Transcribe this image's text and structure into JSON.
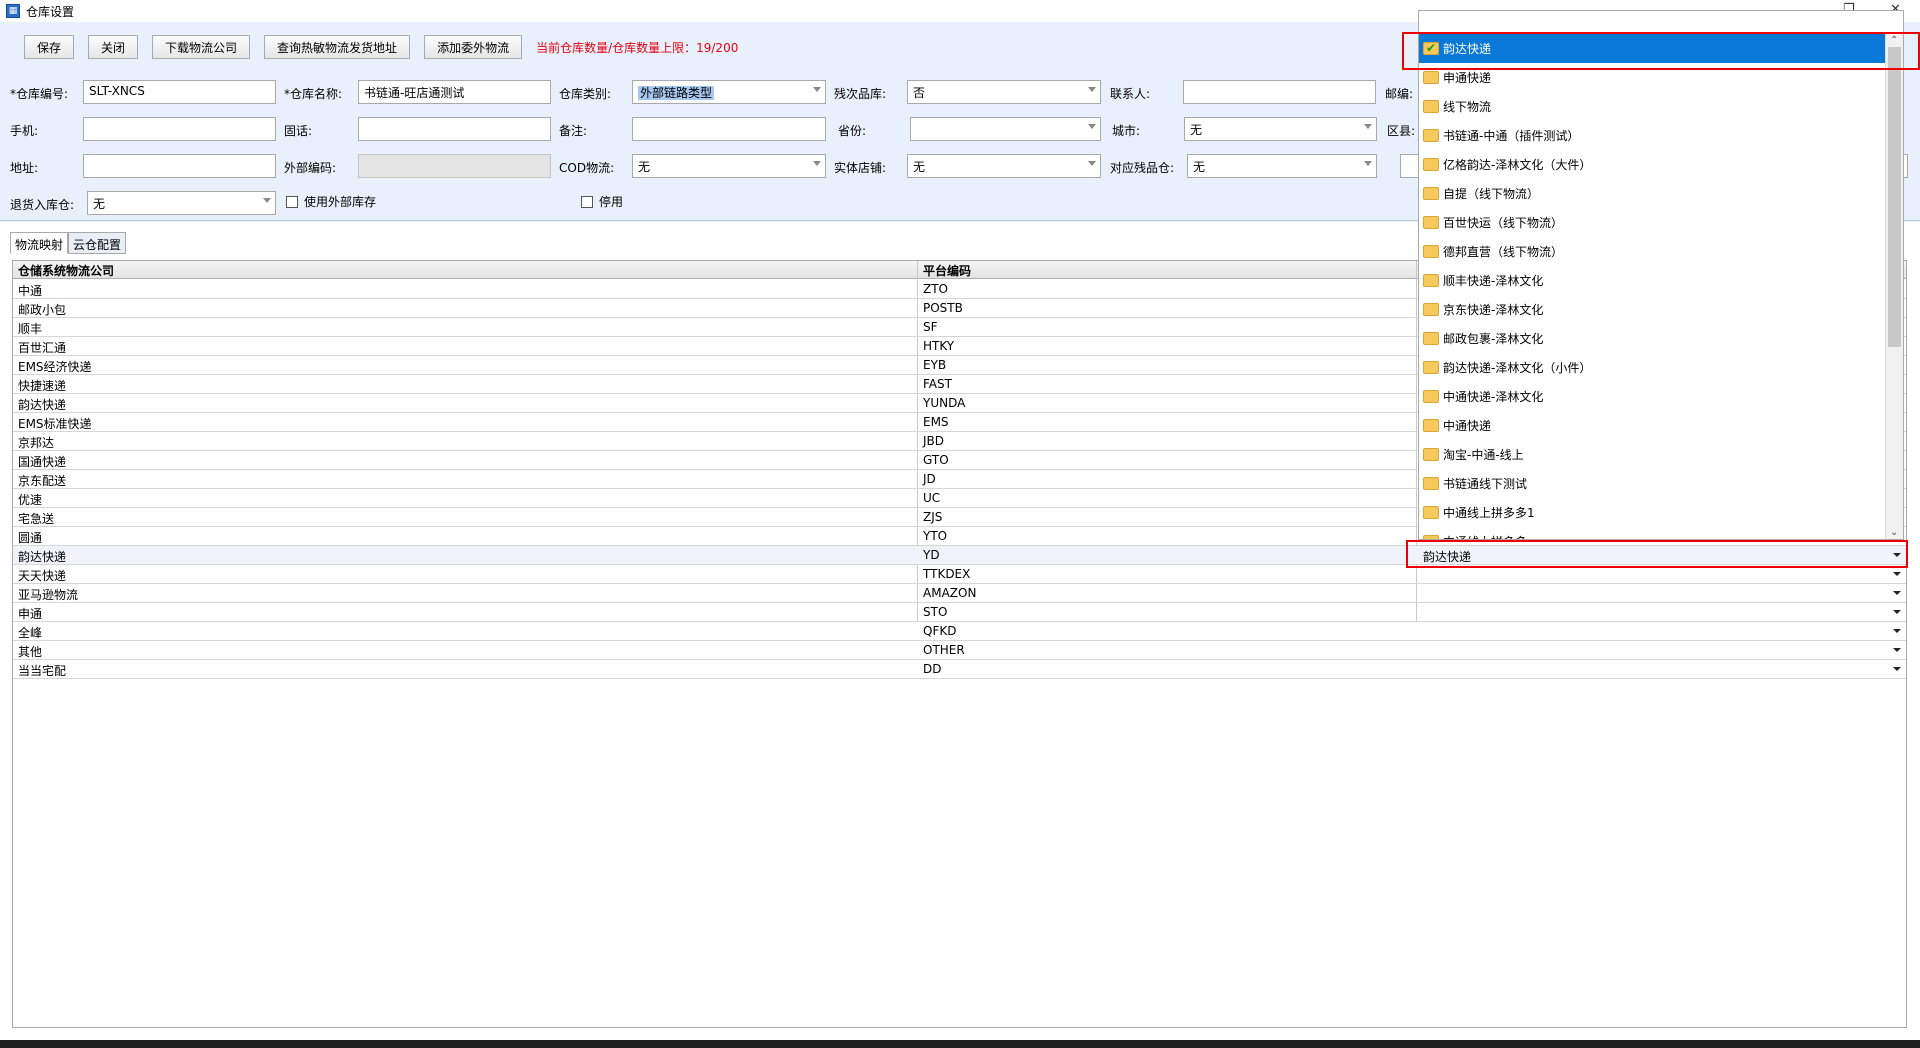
{
  "window": {
    "title": "仓库设置",
    "icon": "window-app-icon",
    "maximize_glyph": "❐",
    "close_glyph": "✕"
  },
  "toolbar": {
    "save": "保存",
    "close": "关闭",
    "download_logistics": "下载物流公司",
    "query_address": "查询热敏物流发货地址",
    "add_outsource": "添加委外物流",
    "quota_text": "当前仓库数量/仓库数量上限：19/200"
  },
  "form": {
    "warehouse_code_label": "*仓库编号:",
    "warehouse_code": "SLT-XNCS",
    "warehouse_name_label": "*仓库名称:",
    "warehouse_name": "书链通-旺店通测试",
    "warehouse_type_label": "仓库类别:",
    "warehouse_type": "外部链路类型",
    "defect_label": "残次品库:",
    "defect_value": "否",
    "contact_label": "联系人:",
    "postcode_label": "邮编:",
    "mobile_label": "手机:",
    "phone_label": "固话:",
    "remark_label": "备注:",
    "province_label": "省份:",
    "city_label": "城市:",
    "city_value": "无",
    "district_label": "区县:",
    "address_label": "地址:",
    "external_code_label": "外部编码:",
    "cod_label": "COD物流:",
    "cod_value": "无",
    "store_label": "实体店铺:",
    "store_value": "无",
    "defect_warehouse_label": "对应残品仓:",
    "defect_warehouse_value": "无",
    "return_warehouse_label": "退货入库仓:",
    "return_warehouse_value": "无",
    "use_external_stock": "使用外部库存",
    "disabled": "停用"
  },
  "tabs": [
    "物流映射",
    "云仓配置"
  ],
  "grid": {
    "headers": [
      "仓储系统物流公司",
      "平台编码"
    ],
    "rows": [
      [
        "中通",
        "ZTO"
      ],
      [
        "邮政小包",
        "POSTB"
      ],
      [
        "顺丰",
        "SF"
      ],
      [
        "百世汇通",
        "HTKY"
      ],
      [
        "EMS经济快递",
        "EYB"
      ],
      [
        "快捷速递",
        "FAST"
      ],
      [
        "韵达快递",
        "YUNDA"
      ],
      [
        "EMS标准快递",
        "EMS"
      ],
      [
        "京邦达",
        "JBD"
      ],
      [
        "国通快递",
        "GTO"
      ],
      [
        "京东配送",
        "JD"
      ],
      [
        "优速",
        "UC"
      ],
      [
        "宅急送",
        "ZJS"
      ],
      [
        "圆通",
        "YTO"
      ],
      [
        "韵达快递",
        "YD"
      ],
      [
        "天天快递",
        "TTKDEX"
      ],
      [
        "亚马逊物流",
        "AMAZON"
      ],
      [
        "申通",
        "STO"
      ],
      [
        "全峰",
        "QFKD"
      ],
      [
        "其他",
        "OTHER"
      ],
      [
        "当当宅配",
        "DD"
      ]
    ],
    "selected_combo_value": "韵达快递"
  },
  "dropdown": {
    "items": [
      "韵达快递",
      "申通快递",
      "线下物流",
      "书链通-中通（插件测试）",
      "亿格韵达-泽林文化（大件）",
      "自提（线下物流）",
      "百世快运（线下物流）",
      "德邦直营（线下物流）",
      "顺丰快递-泽林文化",
      "京东快递-泽林文化",
      "邮政包裹-泽林文化",
      "韵达快递-泽林文化（小件）",
      "中通快递-泽林文化",
      "中通快递",
      "淘宝-中通-线上",
      "书链通线下测试",
      "中通线上拼多多1",
      "中通线上拼多多"
    ],
    "selected_index": 0
  }
}
